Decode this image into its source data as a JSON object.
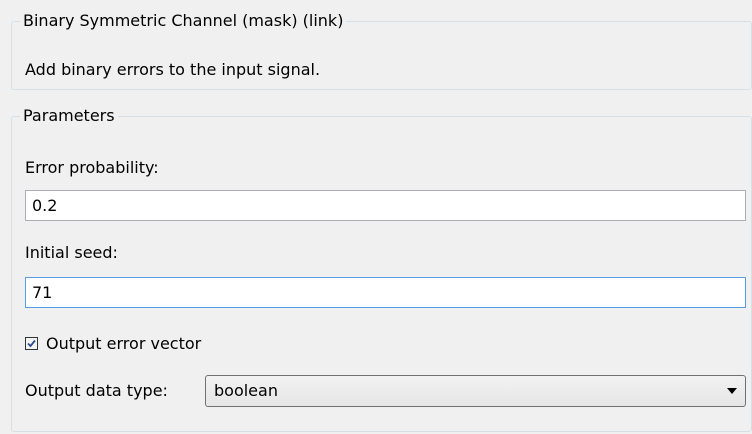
{
  "description_group": {
    "title": "Binary Symmetric Channel (mask) (link)",
    "text": "Add binary errors to the input signal."
  },
  "parameters_group": {
    "title": "Parameters",
    "error_probability": {
      "label": "Error probability:",
      "value": "0.2"
    },
    "initial_seed": {
      "label": "Initial seed:",
      "value": "71"
    },
    "output_error_vector": {
      "label": "Output error vector",
      "checked": true
    },
    "output_data_type": {
      "label": "Output data type:",
      "value": "boolean"
    }
  },
  "icons": {
    "checkbox_check": "check-icon",
    "dropdown": "chevron-down-icon"
  }
}
